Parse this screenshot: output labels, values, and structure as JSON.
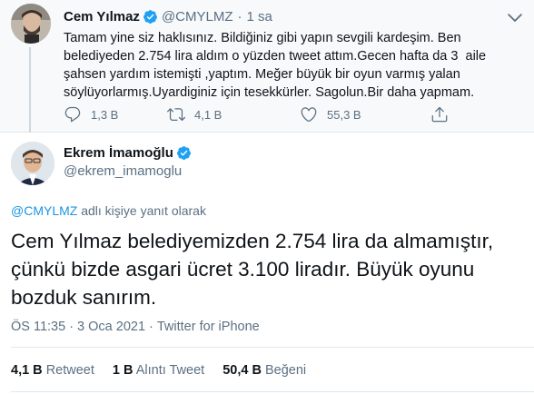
{
  "parent_tweet": {
    "name": "Cem Yılmaz",
    "handle": "@CMYLMZ",
    "separator": "·",
    "time": "1 sa",
    "text": "Tamam yine siz haklısınız. Bildiğiniz gibi yapın sevgili kardeşim. Ben belediyeden 2.754 lira aldım o yüzden tweet attım.Gecen hafta da 3  aile şahsen yardım istemişti ,yaptım. Meğer büyük bir oyun varmış yalan söylüyorlarmış.Uyardiginiz için tesekkürler. Sagolun.Bir daha yapmam.",
    "actions": {
      "reply_icon": "reply-icon",
      "reply_count": "1,3 B",
      "retweet_icon": "retweet-icon",
      "retweet_count": "4,1 B",
      "like_icon": "heart-icon",
      "like_count": "55,3 B",
      "share_icon": "share-icon"
    }
  },
  "main_tweet": {
    "name": "Ekrem İmamoğlu",
    "handle": "@ekrem_imamoglu",
    "replying_mention": "@CMYLMZ",
    "replying_label": " adlı kişiye yanıt olarak",
    "text": "Cem Yılmaz belediyemizden 2.754 lira da almamıştır, çünkü bizde asgari ücret 3.100 liradır. Büyük oyunu bozduk sanırım.",
    "time": "ÖS 11:35",
    "sep1": "·",
    "date": "3 Oca 2021",
    "sep2": "·",
    "source": "Twitter for iPhone",
    "stats": [
      {
        "value": "4,1 B",
        "label": "Retweet"
      },
      {
        "value": "1 B",
        "label": "Alıntı Tweet"
      },
      {
        "value": "50,4 B",
        "label": "Beğeni"
      }
    ]
  },
  "colors": {
    "verified": "#1da1f2",
    "link": "#1b95e0",
    "secondary_text": "#5b7083",
    "parent_bg": "#f7f9fa"
  }
}
